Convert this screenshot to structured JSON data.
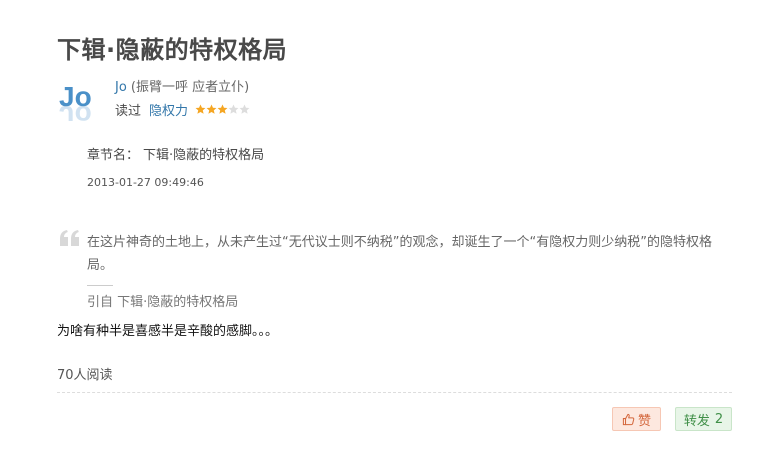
{
  "note": {
    "title": "下辑·隐蔽的特权格局"
  },
  "author": {
    "avatar_text": "Jo",
    "name": "Jo",
    "signature": " (振臂一呼 应者立仆)"
  },
  "reading": {
    "action": "读过",
    "book": "隐权力",
    "rating": 3,
    "rating_max": 5
  },
  "chapter": {
    "label": "章节名：",
    "value": "下辑·隐蔽的特权格局"
  },
  "timestamp": "2013-01-27 09:49:46",
  "quote": {
    "text": "在这片神奇的土地上，从未产生过“无代议士则不纳税”的观念，却诞生了一个“有隐权力则少纳税”的隐特权格局。",
    "source_prefix": "引自 ",
    "source_link": "下辑·隐蔽的特权格局"
  },
  "comment": "为啥有种半是喜感半是辛酸的感脚。。。",
  "read_count": "70人阅读",
  "actions": {
    "like_label": "赞",
    "share_label": "转发",
    "share_count": "2"
  },
  "icons": {
    "star_filled": "star-filled-icon",
    "star_empty": "star-empty-icon",
    "quote": "quote-icon",
    "thumb": "thumbs-up-icon"
  },
  "colors": {
    "link": "#3377aa",
    "star": "#f5a623",
    "like_bg": "#fde8df",
    "like_text": "#d4673c",
    "share_bg": "#e8f5e8",
    "share_text": "#3f8f47"
  }
}
